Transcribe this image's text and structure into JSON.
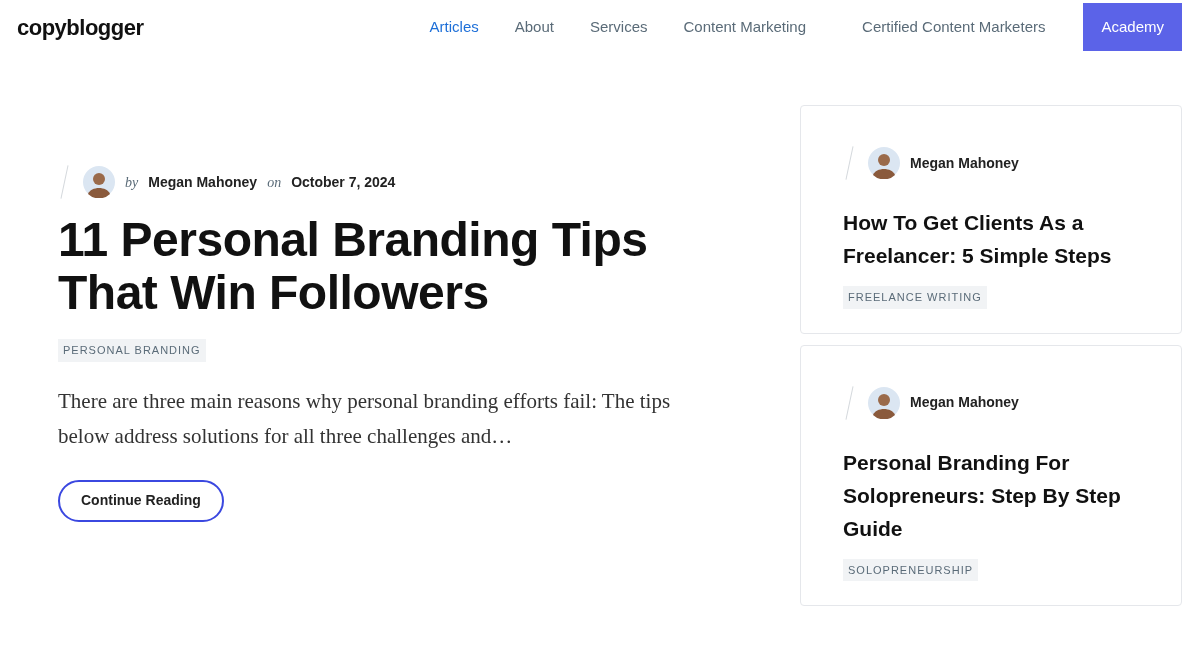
{
  "header": {
    "logo": "copyblogger",
    "nav": [
      {
        "label": "Articles",
        "selected": true,
        "kind": "link"
      },
      {
        "label": "About",
        "selected": false,
        "kind": "link"
      },
      {
        "label": "Services",
        "selected": false,
        "kind": "link"
      },
      {
        "label": "Content Marketing",
        "selected": false,
        "kind": "link"
      },
      {
        "label": "Certified Content Marketers",
        "selected": false,
        "kind": "link"
      },
      {
        "label": "Academy",
        "kind": "button"
      }
    ]
  },
  "featured": {
    "by": "by",
    "author": "Megan Mahoney",
    "on": "on",
    "date": "October 7, 2024",
    "title": "11 Personal Branding Tips That Win Followers",
    "tag": "PERSONAL BRANDING",
    "excerpt": "There are three main reasons why personal branding efforts fail: The tips below address solutions for all three challenges and…",
    "button": "Continue Reading"
  },
  "sidebar_posts": [
    {
      "author": "Megan Mahoney",
      "title": "How To Get Clients As a Freelancer: 5 Simple Steps",
      "tag": "FREELANCE WRITING"
    },
    {
      "author": "Megan Mahoney",
      "title": "Personal Branding For Solopreneurs: Step By Step Guide",
      "tag": "SOLOPRENEURSHIP"
    }
  ]
}
